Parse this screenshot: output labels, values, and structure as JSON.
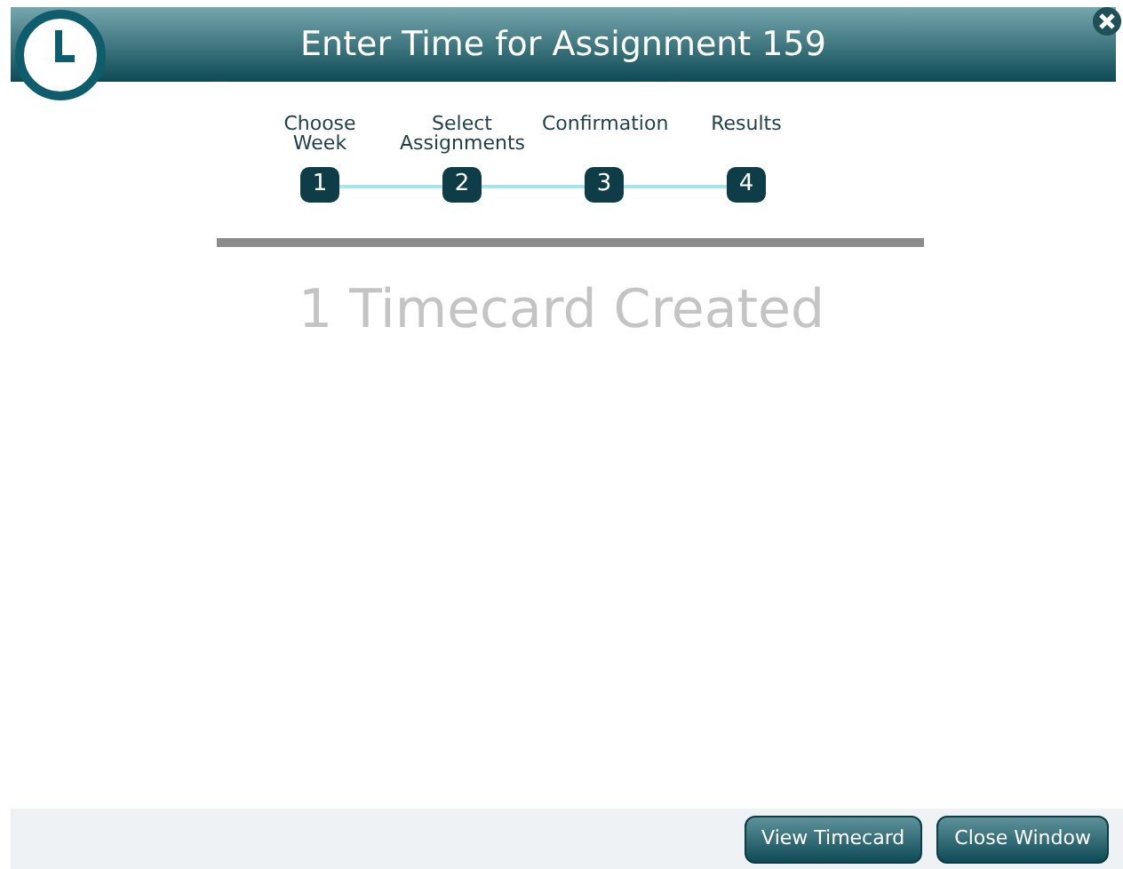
{
  "window": {
    "title": "Enter Time for Assignment 159"
  },
  "steps": [
    {
      "label": "Choose Week",
      "number": "1"
    },
    {
      "label": "Select Assignments",
      "number": "2"
    },
    {
      "label": "Confirmation",
      "number": "3"
    },
    {
      "label": "Results",
      "number": "4"
    }
  ],
  "message": "1 Timecard Created",
  "buttons": [
    "View Timecard",
    "Close Window"
  ]
}
